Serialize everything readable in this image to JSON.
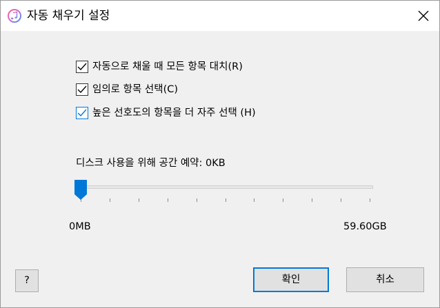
{
  "window": {
    "title": "자동 채우기 설정",
    "app_icon": "itunes-music-note-icon",
    "close_icon": "close-x-icon"
  },
  "options": [
    {
      "label": "자동으로 채울 때 모든 항목 대치(R)",
      "checked": true,
      "focused": false
    },
    {
      "label": "임의로 항목 선택(C)",
      "checked": true,
      "focused": false
    },
    {
      "label": "높은 선호도의 항목을 더 자주 선택 (H)",
      "checked": true,
      "focused": true
    }
  ],
  "disk": {
    "label": "디스크 사용을 위해 공간 예약: 0KB",
    "min_label": "0MB",
    "max_label": "59.60GB",
    "slider_fraction": 0
  },
  "buttons": {
    "help": "?",
    "ok": "확인",
    "cancel": "취소"
  },
  "colors": {
    "accent": "#0078d7",
    "dialog_bg": "#f0f0f0",
    "button_bg": "#e1e1e1"
  }
}
